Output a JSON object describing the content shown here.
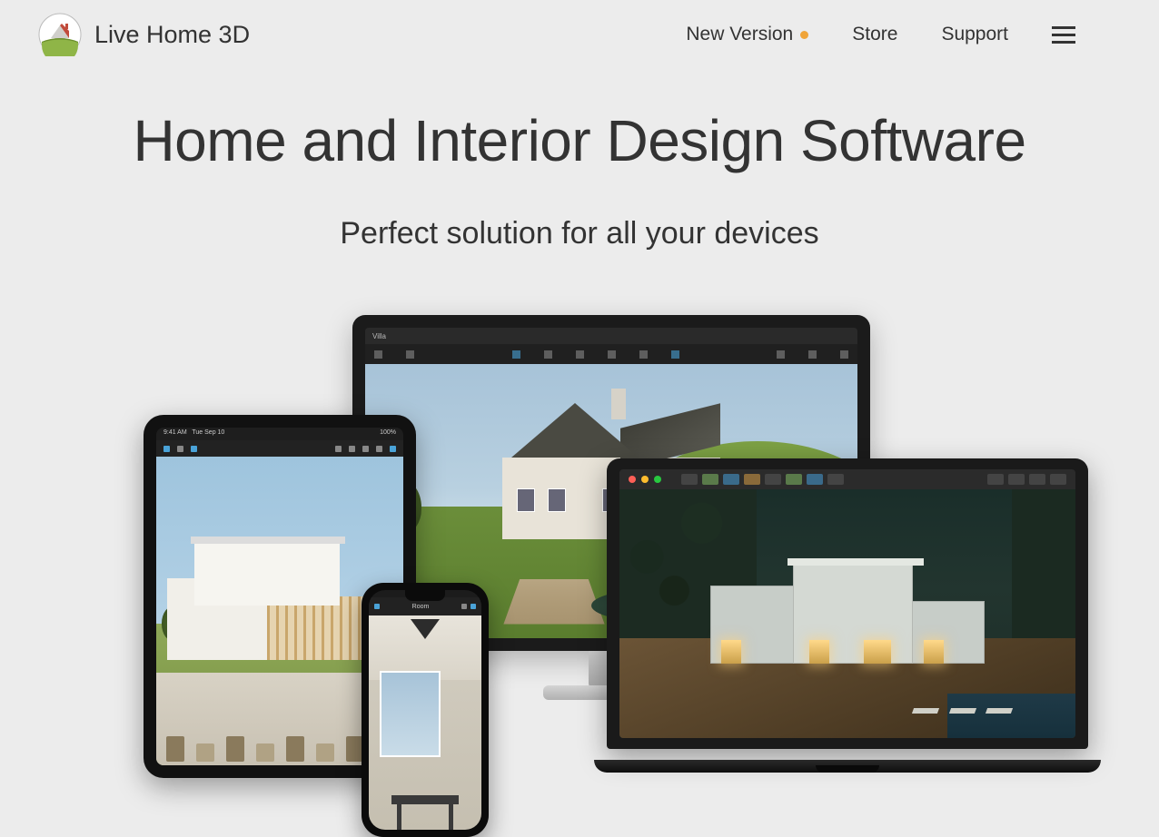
{
  "brand": {
    "name": "Live Home 3D"
  },
  "nav": {
    "new_version": "New Version",
    "store": "Store",
    "support": "Support"
  },
  "hero": {
    "title": "Home and Interior Design Software",
    "subtitle": "Perfect solution for all your devices"
  }
}
